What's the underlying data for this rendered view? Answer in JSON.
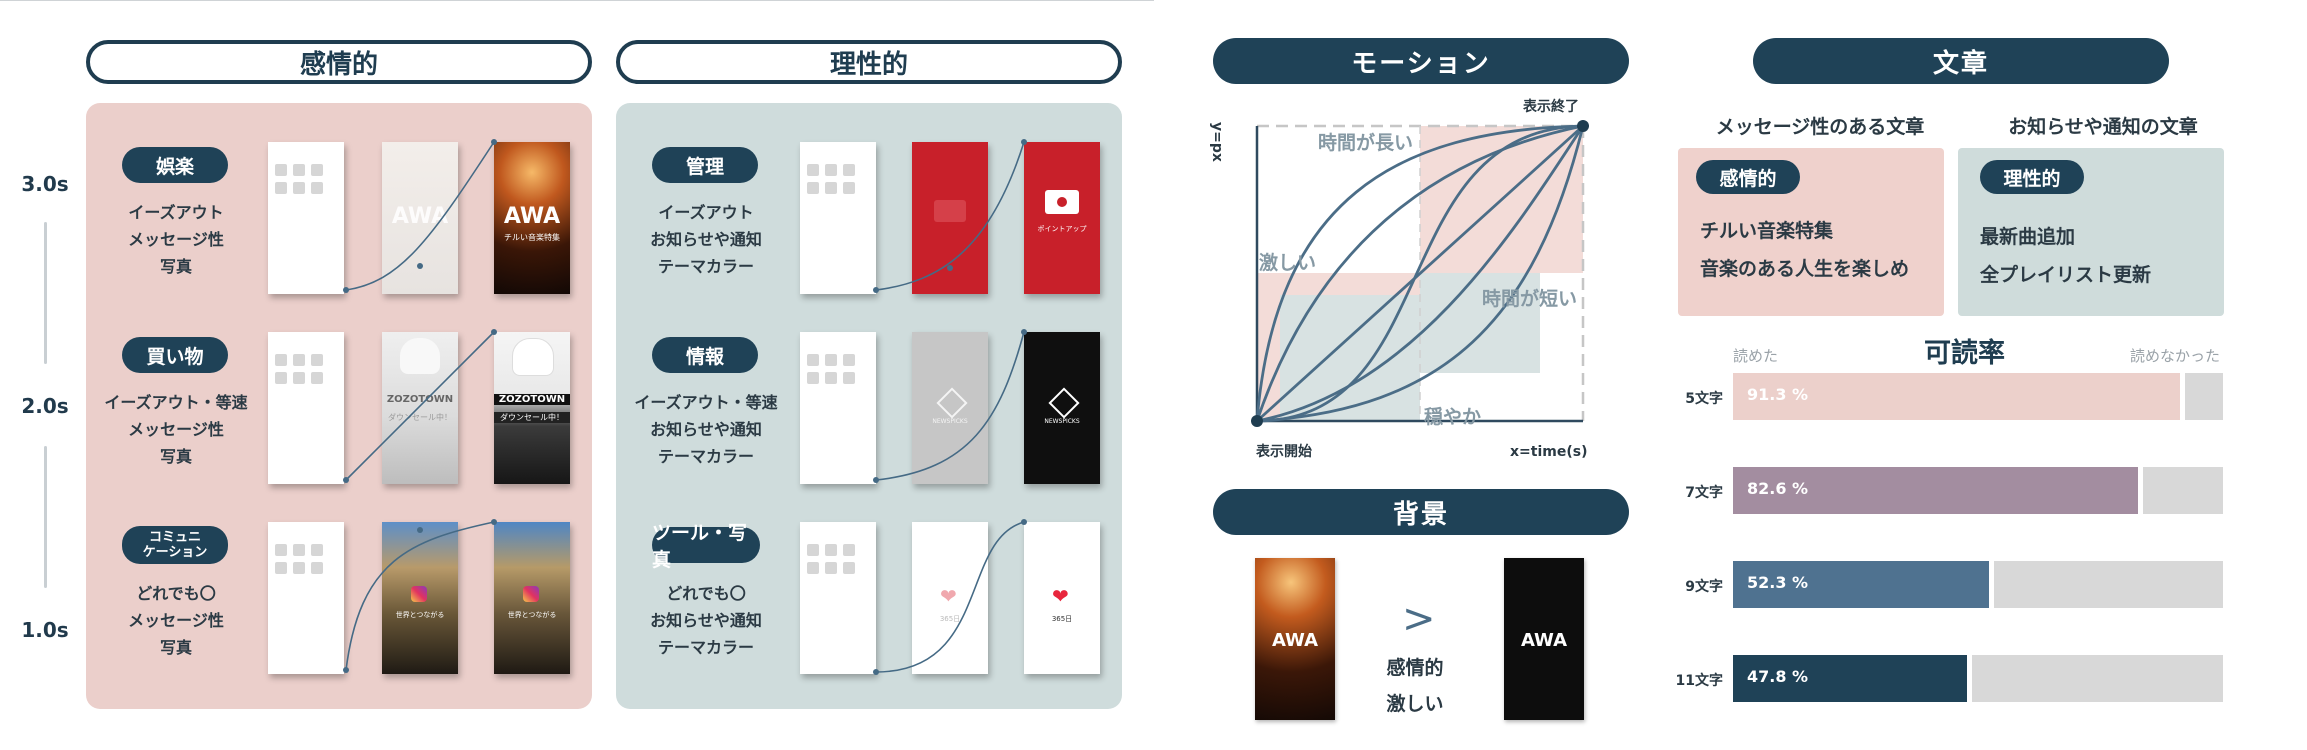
{
  "headings": {
    "emotional": "感情的",
    "rational": "理性的",
    "motion": "モーション",
    "text": "文章",
    "background": "背景"
  },
  "timeline": [
    "3.0s",
    "2.0s",
    "1.0s"
  ],
  "emotional_rows": [
    {
      "tag": "娯楽",
      "desc": [
        "イーズアウト",
        "メッセージ性",
        "写真"
      ],
      "phone2_text": "AWA",
      "phone3_text": "AWA",
      "phone3_sub": "チルい音楽特集"
    },
    {
      "tag": "買い物",
      "desc": [
        "イーズアウト・等速",
        "メッセージ性",
        "写真"
      ],
      "phone2_text": "ZOZOTOWN",
      "phone2_sub": "ダウンセール中！",
      "phone3_text": "ZOZOTOWN",
      "phone3_sub": "ダウンセール中！"
    },
    {
      "tag": "コミュニ\nケーション",
      "desc": [
        "どれでも〇",
        "メッセージ性",
        "写真"
      ],
      "phone2_sub": "世界とつながる",
      "phone3_sub": "世界とつながる"
    }
  ],
  "rational_rows": [
    {
      "tag": "管理",
      "desc": [
        "イーズアウト",
        "お知らせや通知",
        "テーマカラー"
      ],
      "phone3_sub": "ポイントアップ"
    },
    {
      "tag": "情報",
      "desc": [
        "イーズアウト・等速",
        "お知らせや通知",
        "テーマカラー"
      ],
      "phone_text": "NEWSPICKS"
    },
    {
      "tag": "ツール・写真",
      "desc": [
        "どれでも〇",
        "お知らせや通知",
        "テーマカラー"
      ],
      "phone2_sub": "365日",
      "phone3_sub": "365日"
    }
  ],
  "motion_chart": {
    "y_axis": "y=px",
    "x_axis": "x=time(s)",
    "start": "表示開始",
    "end": "表示終了",
    "zones": {
      "long": "時間が長い",
      "intense": "激しい",
      "short": "時間が短い",
      "calm": "穏やか"
    }
  },
  "background_section": {
    "left_logo": "AWA",
    "right_logo": "AWA",
    "arrow": ">",
    "desc": [
      "感情的",
      "激しい"
    ]
  },
  "text_section": {
    "col1_head": "メッセージ性のある文章",
    "col2_head": "お知らせや通知の文章",
    "card1_tag": "感情的",
    "card1_lines": [
      "チルい音楽特集",
      "音楽のある人生を楽しめ"
    ],
    "card2_tag": "理性的",
    "card2_lines": [
      "最新曲追加",
      "全プレイリスト更新"
    ]
  },
  "chart_data": {
    "type": "bar",
    "title": "可読率",
    "left_note": "読めた",
    "right_note": "読めなかった",
    "categories": [
      "5文字",
      "7文字",
      "9文字",
      "11文字"
    ],
    "values": [
      91.3,
      82.6,
      52.3,
      47.8
    ],
    "value_labels": [
      "91.3 %",
      "82.6 %",
      "52.3 %",
      "47.8 %"
    ],
    "colors": [
      "#ecd0cb",
      "#a38da0",
      "#4f7290",
      "#1f4257"
    ],
    "xlim": [
      0,
      100
    ]
  },
  "colors": {
    "navy": "#1f4257",
    "pink_panel": "#ebcfcb",
    "blue_panel": "#cfdcdc",
    "red": "#c8202a"
  }
}
